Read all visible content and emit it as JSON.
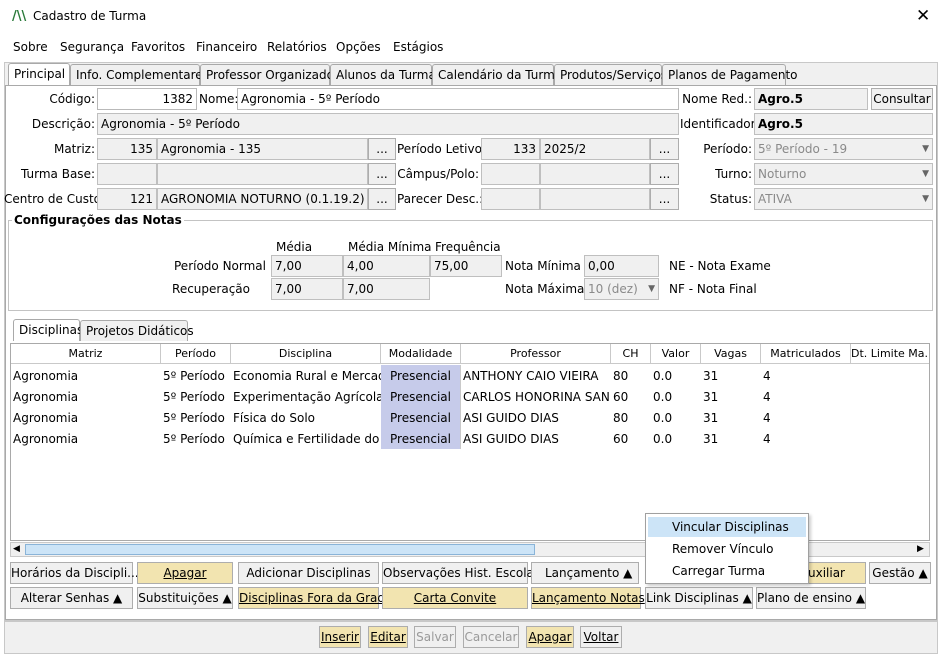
{
  "window": {
    "title": "Cadastro de Turma"
  },
  "menu": [
    "Sobre",
    "Segurança",
    "Favoritos",
    "Financeiro",
    "Relatórios",
    "Opções",
    "Estágios"
  ],
  "tabs": [
    "Principal",
    "Info. Complementares",
    "Professor Organizador",
    "Alunos da Turma",
    "Calendário da Turma",
    "Produtos/Serviços",
    "Planos de Pagamento"
  ],
  "form": {
    "codigo_label": "Código:",
    "codigo": "1382",
    "nome_label": "Nome:",
    "nome": "Agronomia - 5º Período",
    "nome_red_label": "Nome Red.:",
    "nome_red": "Agro.5",
    "consultar": "Consultar",
    "descricao_label": "Descrição:",
    "descricao": "Agronomia - 5º Período",
    "identificador_label": "Identificador:",
    "identificador": "Agro.5",
    "matriz_label": "Matriz:",
    "matriz_code": "135",
    "matriz_name": "Agronomia - 135",
    "periodo_letivo_label": "Período Letivo:",
    "periodo_letivo_code": "133",
    "periodo_letivo": "2025/2",
    "periodo_label": "Período:",
    "periodo": "5º Período - 19",
    "turma_base_label": "Turma Base:",
    "campus_label": "Câmpus/Polo:",
    "turno_label": "Turno:",
    "turno": "Noturno",
    "centro_custo_label": "Centro de Custo:",
    "centro_custo_code": "121",
    "centro_custo": "AGRONOMIA NOTURNO (0.1.19.2)",
    "parecer_label": "Parecer Desc.:",
    "status_label": "Status:",
    "status": "ATIVA",
    "ellipsis": "..."
  },
  "notas": {
    "title": "Configurações das Notas",
    "col_media": "Média",
    "col_media_min": "Média Mínima",
    "col_freq": "Frequência",
    "periodo_normal": "Período Normal",
    "pn_media": "7,00",
    "pn_media_min": "4,00",
    "pn_freq": "75,00",
    "recuperacao": "Recuperação",
    "rec_media": "7,00",
    "rec_media_min": "7,00",
    "nota_minima_label": "Nota Mínima",
    "nota_minima": "0,00",
    "nota_maxima_label": "Nota Máxima",
    "nota_maxima": "10 (dez)",
    "ne": "NE - Nota Exame",
    "nf": "NF - Nota Final"
  },
  "subtabs": [
    "Disciplinas",
    "Projetos Didáticos"
  ],
  "grid": {
    "headers": [
      "Matriz",
      "Período",
      "Disciplina",
      "Modalidade",
      "Professor",
      "CH",
      "Valor",
      "Vagas",
      "Matriculados",
      "Dt. Limite Ma..."
    ],
    "rows": [
      [
        "Agronomia",
        "5º Período",
        "Economia Rural e Mercados",
        "Presencial",
        "ANTHONY CAIO VIEIRA",
        "80",
        "0.0",
        "31",
        "4"
      ],
      [
        "Agronomia",
        "5º Período",
        "Experimentação Agrícola",
        "Presencial",
        "CARLOS HONORINA SAN...",
        "60",
        "0.0",
        "31",
        "4"
      ],
      [
        "Agronomia",
        "5º Período",
        "Física do Solo",
        "Presencial",
        "ASI GUIDO DIAS",
        "80",
        "0.0",
        "31",
        "4"
      ],
      [
        "Agronomia",
        "5º Período",
        "Química e Fertilidade do Solo",
        "Presencial",
        "ASI GUIDO DIAS",
        "60",
        "0.0",
        "31",
        "4"
      ]
    ]
  },
  "buttons": {
    "horarios": "Horários da Discipli...",
    "apagar": "Apagar",
    "adicionar": "Adicionar Disciplinas",
    "obs": "Observações Hist. Escolar",
    "lancamento": "Lançamento",
    "auxiliar": "Auxiliar",
    "gestao": "Gestão",
    "alterar_senhas": "Alterar Senhas",
    "substituicoes": "Substituições",
    "fora_grade": "Disciplinas Fora da Grade",
    "carta": "Carta Convite",
    "lanc_notas": "Lançamento Notas",
    "link": "Link Disciplinas",
    "plano": "Plano de ensino"
  },
  "popup": [
    "Vincular Disciplinas",
    "Remover Vínculo",
    "Carregar Turma"
  ],
  "bottom": [
    "Inserir",
    "Editar",
    "Salvar",
    "Cancelar",
    "Apagar",
    "Voltar"
  ]
}
